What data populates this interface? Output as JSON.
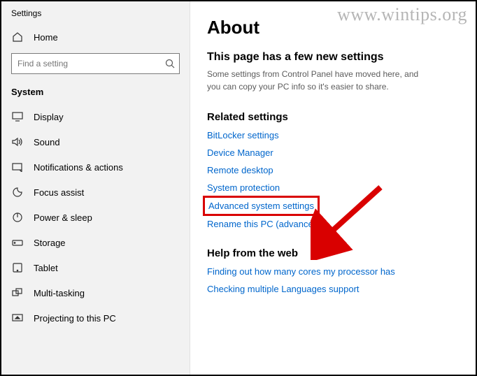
{
  "watermark": "www.wintips.org",
  "sidebar": {
    "title": "Settings",
    "home_label": "Home",
    "search_placeholder": "Find a setting",
    "section_header": "System",
    "items": [
      {
        "label": "Display"
      },
      {
        "label": "Sound"
      },
      {
        "label": "Notifications & actions"
      },
      {
        "label": "Focus assist"
      },
      {
        "label": "Power & sleep"
      },
      {
        "label": "Storage"
      },
      {
        "label": "Tablet"
      },
      {
        "label": "Multi-tasking"
      },
      {
        "label": "Projecting to this PC"
      }
    ]
  },
  "main": {
    "page_title": "About",
    "subheading": "This page has a few new settings",
    "subtext": "Some settings from Control Panel have moved here, and you can copy your PC info so it's easier to share.",
    "related_title": "Related settings",
    "related_links": [
      "BitLocker settings",
      "Device Manager",
      "Remote desktop",
      "System protection",
      "Advanced system settings",
      "Rename this PC (advanced)"
    ],
    "help_title": "Help from the web",
    "help_links": [
      "Finding out how many cores my processor has",
      "Checking multiple Languages support"
    ]
  }
}
